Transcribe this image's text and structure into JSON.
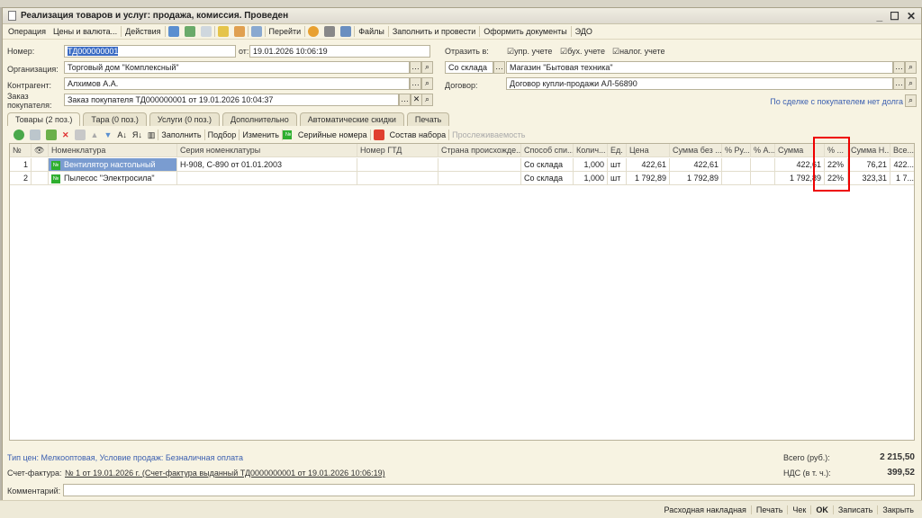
{
  "window": {
    "title": "Реализация товаров и услуг: продажа, комиссия. Проведен"
  },
  "toolbar": {
    "operation": "Операция",
    "prices": "Цены и валюта...",
    "actions": "Действия",
    "goto": "Перейти",
    "files": "Файлы",
    "fill_post": "Заполнить и провести",
    "make_docs": "Оформить документы",
    "edo": "ЭДО"
  },
  "form": {
    "number_label": "Номер:",
    "number": "ТД000000001",
    "date_label": "от:",
    "date": "19.01.2026 10:06:19",
    "org_label": "Организация:",
    "org": "Торговый дом \"Комплексный\"",
    "contractor_label": "Контрагент:",
    "contractor": "Алхимов А.А.",
    "order_label": "Заказ покупателя:",
    "order": "Заказ покупателя ТД000000001 от 19.01.2026 10:04:37",
    "reflect_label": "Отразить в:",
    "cb_mgmt": "упр. учете",
    "cb_acc": "бух. учете",
    "cb_tax": "налог. учете",
    "warehouse_mode": "Со склада",
    "warehouse": "Магазин \"Бытовая техника\"",
    "contract_label": "Договор:",
    "contract": "Договор купли-продажи АЛ-56890",
    "debt_link": "По сделке с покупателем нет долга"
  },
  "tabs": [
    "Товары (2 поз.)",
    "Тара (0 поз.)",
    "Услуги (0 поз.)",
    "Дополнительно",
    "Автоматические скидки",
    "Печать"
  ],
  "table_toolbar": {
    "fill": "Заполнить",
    "pick": "Подбор",
    "change": "Изменить",
    "serials": "Серийные номера",
    "kit": "Состав набора",
    "trace": "Прослеживаемость"
  },
  "table": {
    "headers": [
      "№",
      "",
      "Номенклатура",
      "Серия номенклатуры",
      "Номер ГТД",
      "Страна происхожде...",
      "Способ спи...",
      "Колич...",
      "Ед.",
      "Цена",
      "Сумма без ...",
      "% Ру...",
      "% А...",
      "Сумма",
      "% ...",
      "Сумма Н...",
      "Все..."
    ],
    "rows": [
      [
        "1",
        "",
        "Вентилятор настольный",
        "Н-908, С-890 от 01.01.2003",
        "",
        "",
        "Со склада",
        "1,000",
        "шт",
        "422,61",
        "422,61",
        "",
        "",
        "422,61",
        "22%",
        "76,21",
        "422..."
      ],
      [
        "2",
        "",
        "Пылесос \"Электросила\"",
        "",
        "",
        "",
        "Со склада",
        "1,000",
        "шт",
        "1 792,89",
        "1 792,89",
        "",
        "",
        "1 792,89",
        "22%",
        "323,31",
        "1 7..."
      ]
    ]
  },
  "footer": {
    "price_type": "Тип цен: Мелкооптовая, Условие продаж: Безналичная оплата",
    "total_label": "Всего (руб.):",
    "total": "2 215,50",
    "invoice_label": "Счет-фактура:",
    "invoice": "№ 1 от 19.01.2026 г. (Счет-фактура выданный ТД0000000001 от 19.01.2026 10:06:19)",
    "vat_label": "НДС (в т. ч.):",
    "vat": "399,52",
    "comment_label": "Комментарий:",
    "comment": ""
  },
  "buttons": {
    "waybill": "Расходная накладная",
    "print": "Печать",
    "receipt": "Чек",
    "ok": "OK",
    "save": "Записать",
    "close": "Закрыть"
  }
}
